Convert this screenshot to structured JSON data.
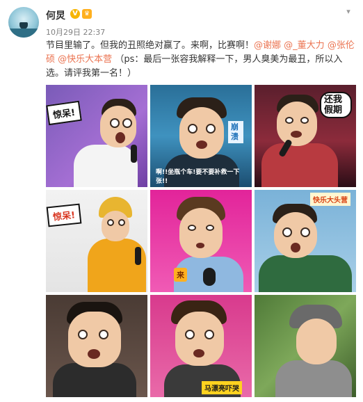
{
  "post": {
    "author": "何炅",
    "timestamp": "10月29日 22:37",
    "text_lead": "节目里输了。但我的丑照绝对赢了。来啊，比赛啊！",
    "mentions": [
      "@谢娜",
      "@_董大力",
      "@张伦硕",
      "@快乐大本营"
    ],
    "text_tail": "（ps：最后一张容我解释一下，男人臭美为最丑，所以入选。请评我第一名！）"
  },
  "icons": {
    "vip": "verified-v-icon",
    "member": "crown-icon",
    "menu": "chevron-down-icon"
  },
  "images": {
    "t1_bubble": "惊呆!",
    "t2_tag": "崩溃",
    "t2_caption": "啊!!坐瓶个车!要不要补救一下 张!!",
    "t3_tag": "还我假期",
    "t4_bubble": "惊呆!",
    "t5_tag": "来",
    "t6_tag": "快乐大头营",
    "t8_tag": "马漂亮吓哭"
  },
  "colors": {
    "mention": "#eb7350",
    "text": "#333333",
    "meta": "#808080"
  }
}
